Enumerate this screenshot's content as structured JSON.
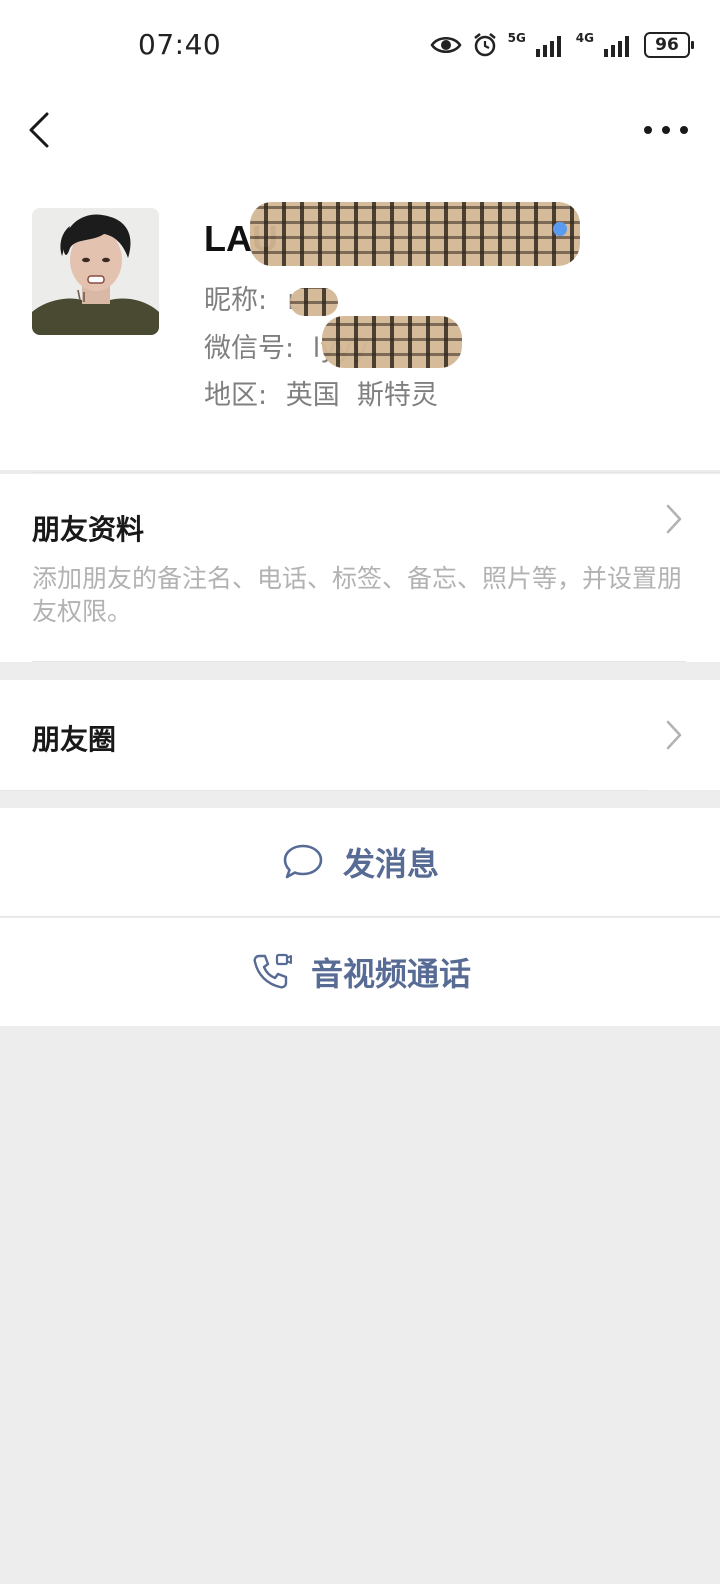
{
  "status_bar": {
    "time": "07:40",
    "network_5g": "5G",
    "network_4g": "4G",
    "battery": "96",
    "icons": [
      "eye-icon",
      "alarm-icon",
      "signal-5g-icon",
      "signal-4g-icon",
      "battery-icon"
    ]
  },
  "nav": {
    "back_icon": "chevron-left-icon",
    "more_icon": "more-dots-icon"
  },
  "profile": {
    "name_visible": "LAU",
    "nickname_label": "昵称:",
    "nickname_visible": "L",
    "wechat_id_label": "微信号:",
    "wechat_id_visible": "lyyy",
    "region_label": "地区:",
    "region_value": "英国  斯特灵",
    "online_dot_color": "#5b9bef"
  },
  "friend_info": {
    "title": "朋友资料",
    "description": "添加朋友的备注名、电话、标签、备忘、照片等，并设置朋友权限。"
  },
  "moments": {
    "title": "朋友圈"
  },
  "actions": {
    "message_label": "发消息",
    "message_icon": "chat-bubble-icon",
    "call_label": "音视频通话",
    "call_icon": "phone-video-icon"
  },
  "colors": {
    "link_blue": "#576b95",
    "background": "#ededed",
    "secondary_text": "#7f7f7f",
    "hint_text": "#b2b2b2"
  }
}
